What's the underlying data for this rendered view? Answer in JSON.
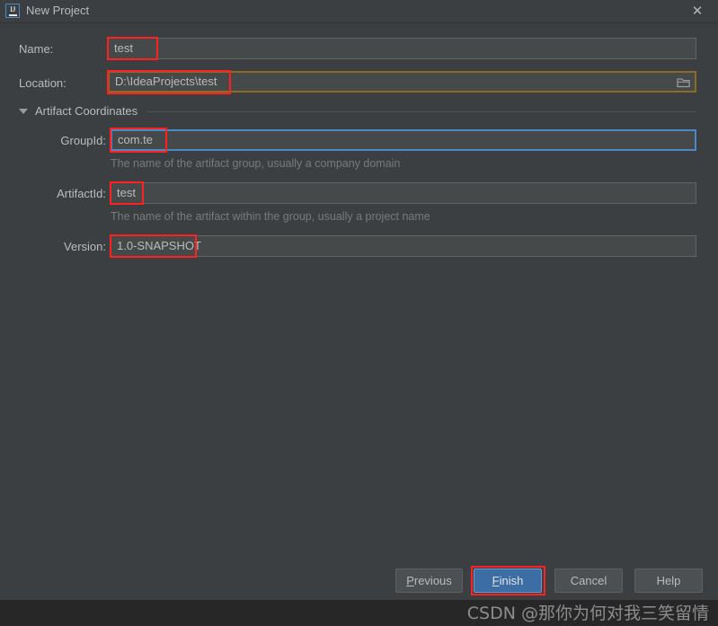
{
  "window": {
    "title": "New Project",
    "app_icon": "intellij-idea-icon",
    "close_icon": "close-icon"
  },
  "form": {
    "name": {
      "label": "Name:",
      "value": "test"
    },
    "location": {
      "label": "Location:",
      "value": "D:\\IdeaProjects\\test",
      "browse_icon": "folder-browse-icon"
    },
    "section": {
      "label": "Artifact Coordinates",
      "expanded_icon": "triangle-down-icon"
    },
    "group_id": {
      "label": "GroupId:",
      "value": "com.te",
      "hint": "The name of the artifact group, usually a company domain"
    },
    "artifact_id": {
      "label": "ArtifactId:",
      "value": "test",
      "hint": "The name of the artifact within the group, usually a project name"
    },
    "version": {
      "label": "Version:",
      "value": "1.0-SNAPSHOT"
    }
  },
  "footer": {
    "previous": "Previous",
    "previous_mnemonic": "P",
    "finish": "Finish",
    "finish_mnemonic": "F",
    "cancel": "Cancel",
    "help": "Help"
  },
  "watermark": {
    "text": "CSDN @那你为何对我三笑留情"
  },
  "colors": {
    "background": "#3c3f41",
    "field_background": "#45494a",
    "focus_blue": "#4a88c7",
    "focus_olive": "#8a6d22",
    "primary_button": "#3c6ea5",
    "annotation_red": "#ff2020",
    "footer_band": "#272727"
  }
}
